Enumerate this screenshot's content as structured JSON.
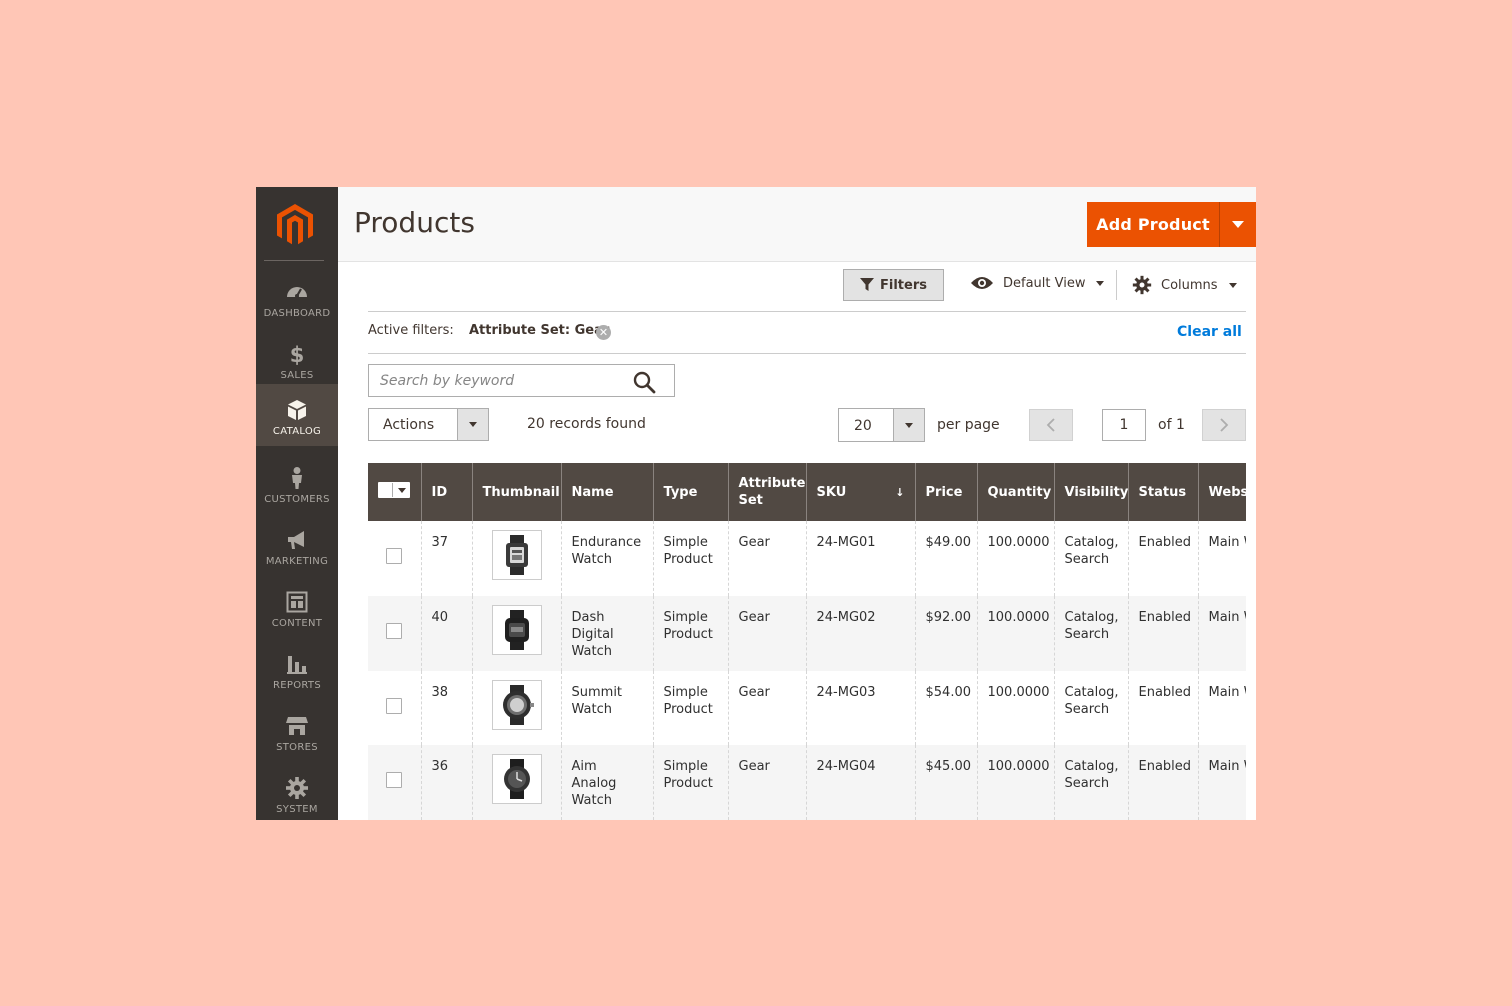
{
  "sidebar": {
    "items": [
      {
        "label": "Dashboard",
        "icon": "speedometer-icon",
        "active": false
      },
      {
        "label": "Sales",
        "icon": "dollar-icon",
        "active": false
      },
      {
        "label": "Catalog",
        "icon": "cube-icon",
        "active": true
      },
      {
        "label": "Customers",
        "icon": "person-icon",
        "active": false
      },
      {
        "label": "Marketing",
        "icon": "megaphone-icon",
        "active": false
      },
      {
        "label": "Content",
        "icon": "layout-icon",
        "active": false
      },
      {
        "label": "Reports",
        "icon": "bar-chart-icon",
        "active": false
      },
      {
        "label": "Stores",
        "icon": "storefront-icon",
        "active": false
      },
      {
        "label": "System",
        "icon": "gear-icon",
        "active": false
      }
    ]
  },
  "header": {
    "title": "Products",
    "add_product_label": "Add Product"
  },
  "toolbar": {
    "filters_label": "Filters",
    "view_label": "Default View",
    "columns_label": "Columns"
  },
  "filters": {
    "active_label": "Active filters:",
    "chip_label": "Attribute Set: Gear",
    "clear_all_label": "Clear all"
  },
  "search": {
    "placeholder": "Search by keyword",
    "value": ""
  },
  "actions": {
    "label": "Actions",
    "records_found": "20 records found"
  },
  "pagination": {
    "per_page_value": "20",
    "per_page_label": "per page",
    "current_page": "1",
    "of_label": "of 1"
  },
  "grid": {
    "headers": [
      "ID",
      "Thumbnail",
      "Name",
      "Type",
      "Attribute Set",
      "SKU",
      "Price",
      "Quantity",
      "Visibility",
      "Status",
      "Websi"
    ],
    "sort_indicator": "↓",
    "rows": [
      {
        "id": "37",
        "name": "Endurance Watch",
        "type": "Simple Product",
        "attribute_set": "Gear",
        "sku": "24-MG01",
        "price": "$49.00",
        "quantity": "100.0000",
        "visibility": "Catalog, Search",
        "status": "Enabled",
        "website": "Main Websi"
      },
      {
        "id": "40",
        "name": "Dash Digital Watch",
        "type": "Simple Product",
        "attribute_set": "Gear",
        "sku": "24-MG02",
        "price": "$92.00",
        "quantity": "100.0000",
        "visibility": "Catalog, Search",
        "status": "Enabled",
        "website": "Main Websi"
      },
      {
        "id": "38",
        "name": "Summit Watch",
        "type": "Simple Product",
        "attribute_set": "Gear",
        "sku": "24-MG03",
        "price": "$54.00",
        "quantity": "100.0000",
        "visibility": "Catalog, Search",
        "status": "Enabled",
        "website": "Main Websi"
      },
      {
        "id": "36",
        "name": "Aim Analog Watch",
        "type": "Simple Product",
        "attribute_set": "Gear",
        "sku": "24-MG04",
        "price": "$45.00",
        "quantity": "100.0000",
        "visibility": "Catalog, Search",
        "status": "Enabled",
        "website": "Main Websi"
      }
    ]
  },
  "colors": {
    "brand": "#eb5202",
    "sidebar_bg": "#373330",
    "header_row_bg": "#514943",
    "link": "#007bdb",
    "page_bg": "#ffc6b6"
  }
}
